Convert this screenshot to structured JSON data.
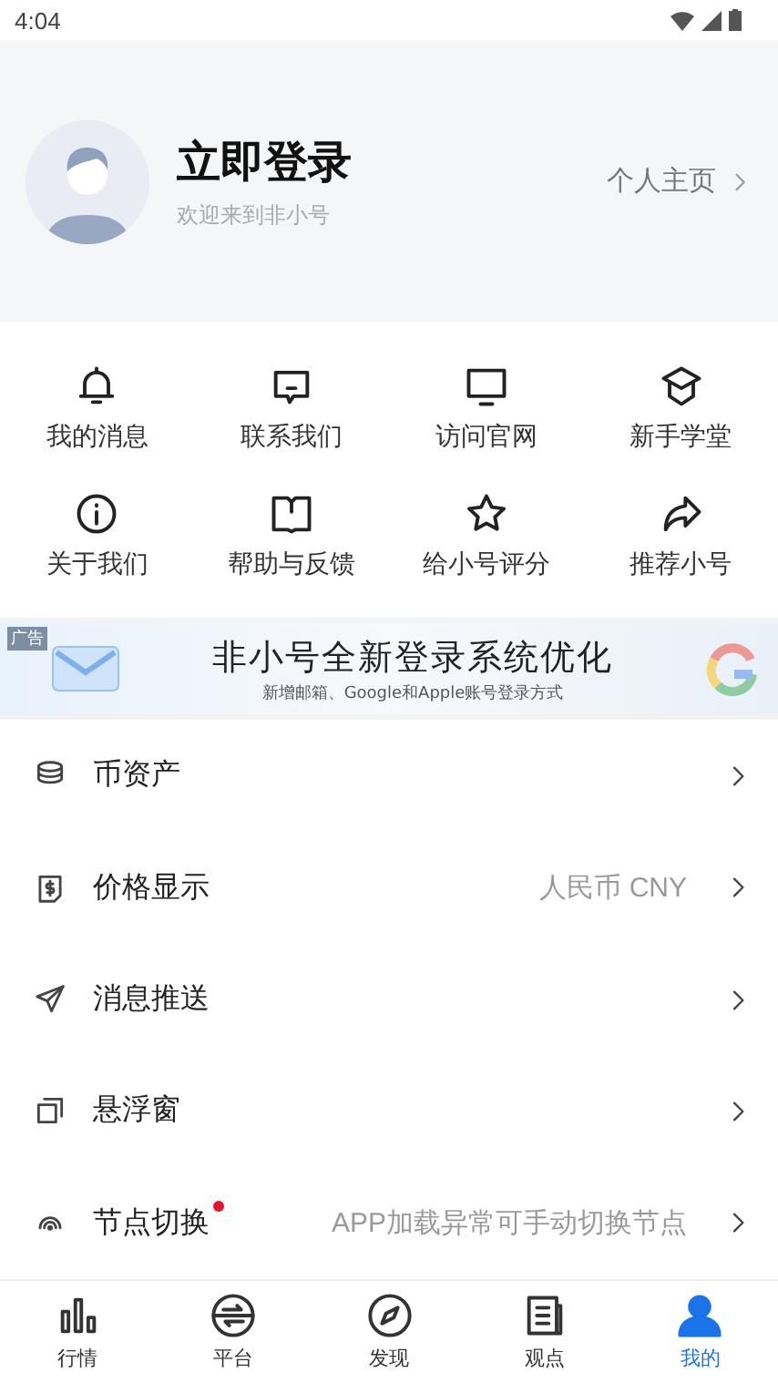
{
  "status_bar": {
    "time": "4:04"
  },
  "profile": {
    "title": "立即登录",
    "subtitle": "欢迎来到非小号",
    "link": "个人主页"
  },
  "shortcuts": [
    {
      "label": "我的消息"
    },
    {
      "label": "联系我们"
    },
    {
      "label": "访问官网"
    },
    {
      "label": "新手学堂"
    },
    {
      "label": "关于我们"
    },
    {
      "label": "帮助与反馈"
    },
    {
      "label": "给小号评分"
    },
    {
      "label": "推荐小号"
    }
  ],
  "banner": {
    "tag": "广告",
    "title": "非小号全新登录系统优化",
    "subtitle": "新增邮箱、Google和Apple账号登录方式"
  },
  "menu": [
    {
      "label": "币资产",
      "new": false
    },
    {
      "label": "价格显示",
      "value": "人民币 CNY",
      "new": false
    },
    {
      "label": "消息推送",
      "new": false
    },
    {
      "label": "悬浮窗",
      "new": false
    },
    {
      "label": "节点切换",
      "value": "APP加载异常可手动切换节点",
      "new": true
    }
  ],
  "tabs": [
    {
      "label": "行情",
      "selected": false
    },
    {
      "label": "平台",
      "selected": false
    },
    {
      "label": "发现",
      "selected": false
    },
    {
      "label": "观点",
      "selected": false
    },
    {
      "label": "我的",
      "selected": true
    }
  ]
}
